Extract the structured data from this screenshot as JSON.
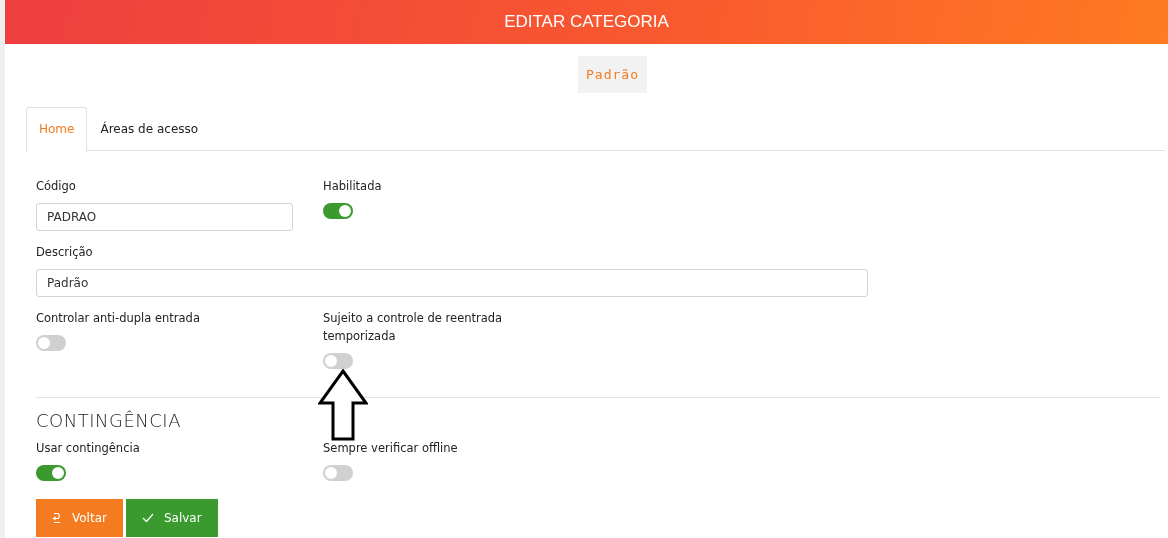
{
  "header": {
    "title": "EDITAR CATEGORIA"
  },
  "badge": "Padrão",
  "tabs": [
    {
      "label": "Home",
      "selected": true
    },
    {
      "label": "Áreas de acesso",
      "selected": false
    }
  ],
  "row1": {
    "code": {
      "label": "Código",
      "value": "PADRAO"
    },
    "enabled": {
      "label": "Habilitada",
      "on": true
    }
  },
  "description": {
    "label": "Descrição",
    "value": "Padrão"
  },
  "row2": [
    {
      "label": "Controlar anti-dupla entrada",
      "on": false
    },
    {
      "label": "Sujeito a controle de reentrada temporizada",
      "on": false
    }
  ],
  "contingency": {
    "title": "CONTINGÊNCIA",
    "toggles": [
      {
        "label": "Usar contingência",
        "on": true
      },
      {
        "label": "Sempre verificar offline",
        "on": false
      }
    ]
  },
  "buttons": [
    {
      "kind": "back",
      "label": "Voltar"
    },
    {
      "kind": "save",
      "label": "Salvar"
    }
  ]
}
